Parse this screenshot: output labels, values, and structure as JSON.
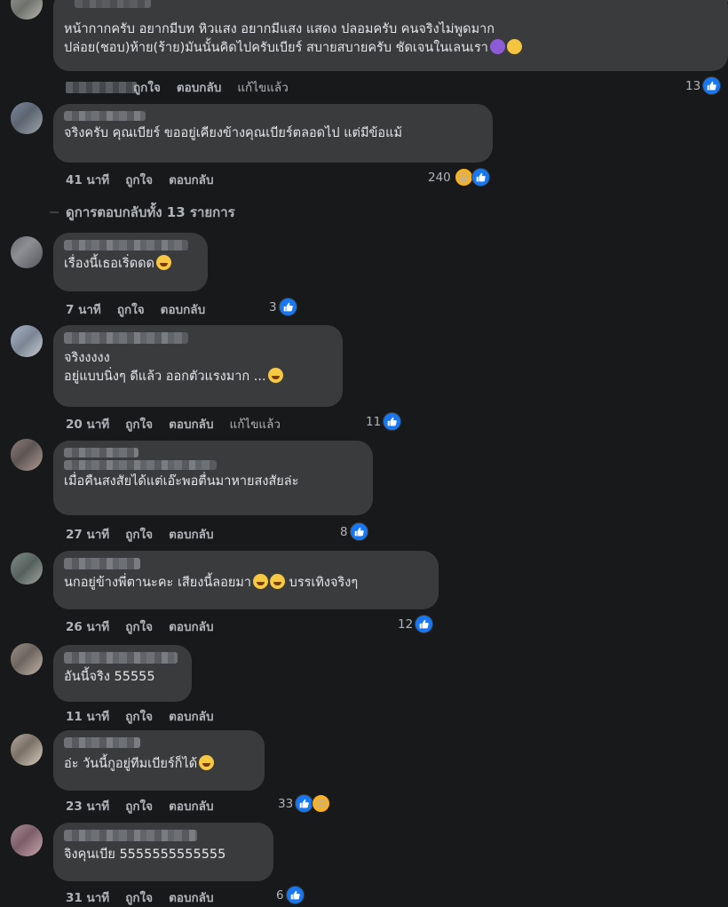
{
  "comments": [
    {
      "text": "หน้ากากครับ อยากมีบท หิวแสง อยากมีแสง แสดง ปลอมครับ คนจริงไม่พูดมาก\nปล่อย(ชอบ)ห้าย(ร้าย)มันนั้นคิดไปครับเบียร์ สบายสบายครับ ชัดเจนในเลนเรา",
      "like": "ถูกใจ",
      "reply": "ตอบกลับ",
      "edited": "แก้ไขแล้ว",
      "count": "13"
    },
    {
      "text": "จริงครับ คุณเบียร์ ขออยู่เคียงข้างคุณเบียร์ตลอดไป แต่มีข้อแม้",
      "time": "41 นาที",
      "like": "ถูกใจ",
      "reply": "ตอบกลับ",
      "count": "240"
    },
    {
      "text": "เรื่องนี้เธอเริ่ดดด",
      "time": "7 นาที",
      "like": "ถูกใจ",
      "reply": "ตอบกลับ",
      "count": "3"
    },
    {
      "text": "จริงงงงง\nอยู่แบบนิ่งๆ ดีแล้ว ออกตัวแรงมาก ...",
      "time": "20 นาที",
      "like": "ถูกใจ",
      "reply": "ตอบกลับ",
      "edited": "แก้ไขแล้ว",
      "count": "11"
    },
    {
      "text": "เมื่อคืนสงสัยได้แต่เอ๊ะพอตื่นมาหายสงสัยล่ะ",
      "time": "27 นาที",
      "like": "ถูกใจ",
      "reply": "ตอบกลับ",
      "count": "8"
    },
    {
      "text": "นกอยู่ข้างพี่ตานะคะ เสียงนี้ลอยมา",
      "text_after": " บรรเทิงจริงๆ",
      "time": "26 นาที",
      "like": "ถูกใจ",
      "reply": "ตอบกลับ",
      "count": "12"
    },
    {
      "text": "อันนี้จริง 55555",
      "time": "11 นาที",
      "like": "ถูกใจ",
      "reply": "ตอบกลับ"
    },
    {
      "text": "อ่ะ วันนี้กูอยู่ทีมเบียร์ก็ได้",
      "time": "23 นาที",
      "like": "ถูกใจ",
      "reply": "ตอบกลับ",
      "count": "33"
    },
    {
      "text": "จิงคุนเบีย 5555555555555",
      "time": "31 นาที",
      "like": "ถูกใจ",
      "reply": "ตอบกลับ",
      "count": "6"
    }
  ],
  "view_replies": "ดูการตอบกลับทั้ง 13 รายการ",
  "colors": {
    "bubble": "#3a3b3c",
    "background": "#18191a",
    "like_blue": "#1877f2"
  },
  "icons": [
    "like-icon",
    "laugh-icon"
  ]
}
